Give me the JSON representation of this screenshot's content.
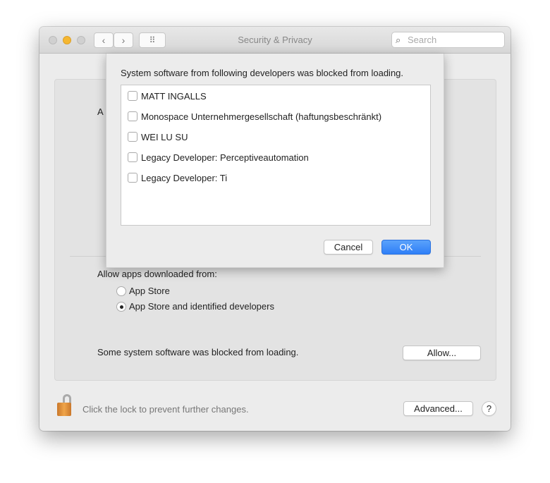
{
  "window": {
    "title": "Security & Privacy",
    "search_placeholder": "Search",
    "back": "‹",
    "forward": "›",
    "grid": "⠿"
  },
  "panel": {
    "partial_label": "A",
    "allow_from_label": "Allow apps downloaded from:",
    "options": [
      {
        "label": "App Store",
        "selected": false
      },
      {
        "label": "App Store and identified developers",
        "selected": true
      }
    ],
    "blocked_text": "Some system software was blocked from loading.",
    "allow_button": "Allow..."
  },
  "footer": {
    "lock_text": "Click the lock to prevent further changes.",
    "advanced_button": "Advanced...",
    "help": "?"
  },
  "sheet": {
    "message": "System software from following developers was blocked from loading.",
    "developers": [
      {
        "name": "MATT INGALLS",
        "checked": false
      },
      {
        "name": "Monospace Unternehmergesellschaft (haftungsbeschränkt)",
        "checked": false
      },
      {
        "name": "WEI LU SU",
        "checked": false
      },
      {
        "name": "Legacy Developer: Perceptiveautomation",
        "checked": false
      },
      {
        "name": "Legacy Developer: Ti",
        "checked": false
      }
    ],
    "cancel": "Cancel",
    "ok": "OK",
    "accent": "#2f7ff7"
  }
}
